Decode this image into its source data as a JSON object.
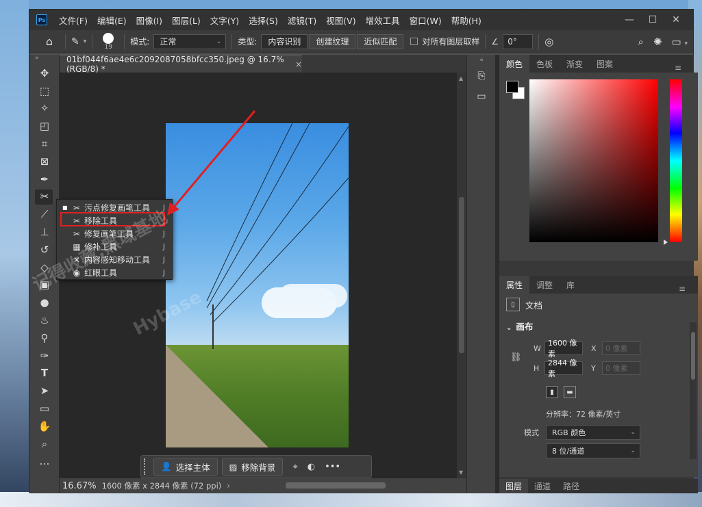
{
  "app": {
    "logo": "Ps",
    "menu": [
      "文件(F)",
      "编辑(E)",
      "图像(I)",
      "图层(L)",
      "文字(Y)",
      "选择(S)",
      "滤镜(T)",
      "视图(V)",
      "增效工具",
      "窗口(W)",
      "帮助(H)"
    ],
    "window_controls": [
      "—",
      "☐",
      "✕"
    ]
  },
  "options_bar": {
    "brush_size": "19",
    "mode_label": "模式:",
    "mode_value": "正常",
    "type_label": "类型:",
    "type_options": [
      "内容识别",
      "创建纹理",
      "近似匹配"
    ],
    "sample_all_label": "对所有图层取样",
    "angle_value": "0°"
  },
  "document": {
    "tab_title": "01bf044f6ae4e6c2092087058bfcc350.jpeg @ 16.7%(RGB/8) *",
    "tab_close": "×"
  },
  "context_bar": {
    "select_subject": "选择主体",
    "remove_bg": "移除背景"
  },
  "status": {
    "zoom": "16.67%",
    "info": "1600 像素 x 2844 像素 (72 ppi)",
    "arrow": "›"
  },
  "flyout": {
    "items": [
      {
        "label": "污点修复画笔工具",
        "key": "J",
        "icon": "spot-heal-icon",
        "selected": true
      },
      {
        "label": "移除工具",
        "key": "J",
        "icon": "remove-tool-icon",
        "selected": false
      },
      {
        "label": "修复画笔工具",
        "key": "J",
        "icon": "healing-brush-icon",
        "selected": false
      },
      {
        "label": "修补工具",
        "key": "J",
        "icon": "patch-icon",
        "selected": false
      },
      {
        "label": "内容感知移动工具",
        "key": "J",
        "icon": "content-aware-move-icon",
        "selected": false
      },
      {
        "label": "红眼工具",
        "key": "J",
        "icon": "red-eye-icon",
        "selected": false
      }
    ]
  },
  "watermark": {
    "line1": "记得收藏:黑域基地",
    "line2": "Hybase"
  },
  "panels": {
    "color_tabs": [
      "颜色",
      "色板",
      "渐变",
      "图案"
    ],
    "props_tabs": [
      "属性",
      "调整",
      "库"
    ],
    "doc_label": "文档",
    "canvas_label": "画布",
    "w_label": "W",
    "w_value": "1600 像素",
    "h_label": "H",
    "h_value": "2844 像素",
    "x_label": "X",
    "x_value": "0 像素",
    "y_label": "Y",
    "y_value": "0 像素",
    "resolution": "分辨率：72 像素/英寸",
    "mode_label": "模式",
    "mode_value": "RGB 颜色",
    "depth_value": "8 位/通道",
    "layer_tabs": [
      "图层",
      "通道",
      "路径"
    ]
  },
  "colors": {
    "highlight": "#e02020",
    "accent": "#31a8ff"
  }
}
